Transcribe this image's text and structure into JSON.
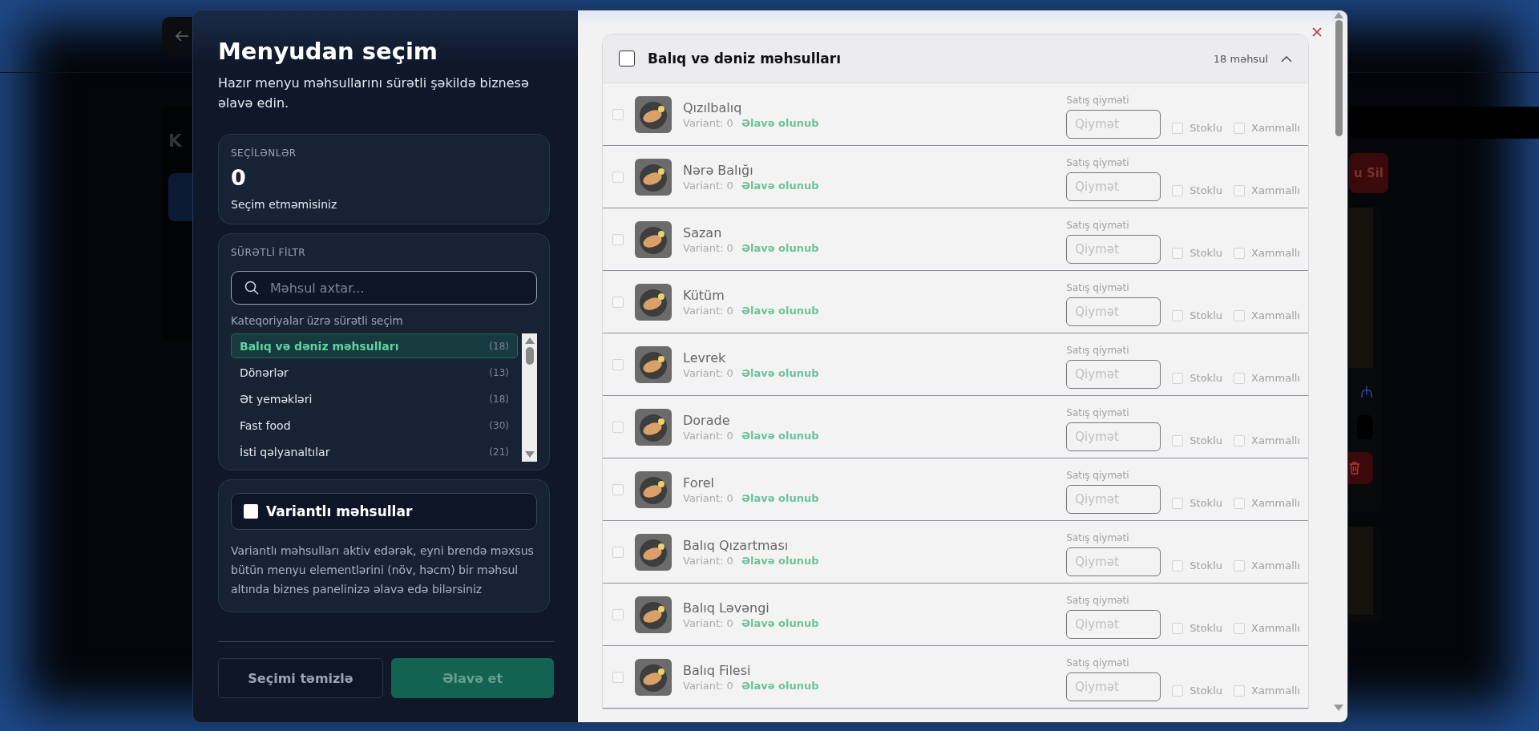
{
  "background": {
    "heading": "K",
    "delete_button": "u Sil",
    "currency": "₼"
  },
  "dialog": {
    "title": "Menyudan seçim",
    "subtitle": "Hazır menyu məhsullarını sürətli şəkildə biznesə əlavə edin.",
    "selected_card": {
      "label": "SEÇİLƏNLƏR",
      "count": "0",
      "note": "Seçim etməmisiniz"
    },
    "filter": {
      "label": "SÜRƏTLİ FİLTR",
      "search_placeholder": "Məhsul axtar...",
      "categories_label": "Kateqoriyalar üzrə sürətli seçim",
      "categories": [
        {
          "name": "Balıq və dəniz məhsulları",
          "count": "(18)",
          "selected": true
        },
        {
          "name": "Dönərlər",
          "count": "(13)",
          "selected": false
        },
        {
          "name": "Ət yeməkləri",
          "count": "(18)",
          "selected": false
        },
        {
          "name": "Fast food",
          "count": "(30)",
          "selected": false
        },
        {
          "name": "İsti qəlyanaltılar",
          "count": "(21)",
          "selected": false
        }
      ]
    },
    "variants": {
      "label": "Variantlı məhsullar",
      "checked": false,
      "description": "Variantlı məhsulları aktiv edərək, eyni brendə məxsus bütün menyu elementlərini (növ, həcm) bir məhsul altında biznes panelinizə əlavə edə bilərsiniz"
    },
    "buttons": {
      "clear": "Seçimi təmizlə",
      "add": "Əlavə et"
    },
    "group": {
      "title": "Balıq və dəniz məhsulları",
      "checked": false,
      "count": "18 məhsul",
      "expanded": true,
      "products": [
        {
          "name": "Qızılbalıq",
          "variant": "Variant: 0",
          "status": "Əlavə olunub",
          "price_label": "Satış qiyməti",
          "price_placeholder": "Qiymət",
          "checked": false,
          "stock_label": "Stoklu",
          "stock": false,
          "ingredient_label": "Xammallı",
          "ingredient": false
        },
        {
          "name": "Nərə Balığı",
          "variant": "Variant: 0",
          "status": "Əlavə olunub",
          "price_label": "Satış qiyməti",
          "price_placeholder": "Qiymət",
          "checked": false,
          "stock_label": "Stoklu",
          "stock": false,
          "ingredient_label": "Xammallı",
          "ingredient": false
        },
        {
          "name": "Sazan",
          "variant": "Variant: 0",
          "status": "Əlavə olunub",
          "price_label": "Satış qiyməti",
          "price_placeholder": "Qiymət",
          "checked": false,
          "stock_label": "Stoklu",
          "stock": false,
          "ingredient_label": "Xammallı",
          "ingredient": false
        },
        {
          "name": "Kütüm",
          "variant": "Variant: 0",
          "status": "Əlavə olunub",
          "price_label": "Satış qiyməti",
          "price_placeholder": "Qiymət",
          "checked": false,
          "stock_label": "Stoklu",
          "stock": false,
          "ingredient_label": "Xammallı",
          "ingredient": false
        },
        {
          "name": "Levrek",
          "variant": "Variant: 0",
          "status": "Əlavə olunub",
          "price_label": "Satış qiyməti",
          "price_placeholder": "Qiymət",
          "checked": false,
          "stock_label": "Stoklu",
          "stock": false,
          "ingredient_label": "Xammallı",
          "ingredient": false
        },
        {
          "name": "Dorade",
          "variant": "Variant: 0",
          "status": "Əlavə olunub",
          "price_label": "Satış qiyməti",
          "price_placeholder": "Qiymət",
          "checked": false,
          "stock_label": "Stoklu",
          "stock": false,
          "ingredient_label": "Xammallı",
          "ingredient": false
        },
        {
          "name": "Forel",
          "variant": "Variant: 0",
          "status": "Əlavə olunub",
          "price_label": "Satış qiyməti",
          "price_placeholder": "Qiymət",
          "checked": false,
          "stock_label": "Stoklu",
          "stock": false,
          "ingredient_label": "Xammallı",
          "ingredient": false
        },
        {
          "name": "Balıq Qızartması",
          "variant": "Variant: 0",
          "status": "Əlavə olunub",
          "price_label": "Satış qiyməti",
          "price_placeholder": "Qiymət",
          "checked": false,
          "stock_label": "Stoklu",
          "stock": false,
          "ingredient_label": "Xammallı",
          "ingredient": false
        },
        {
          "name": "Balıq Ləvəngi",
          "variant": "Variant: 0",
          "status": "Əlavə olunub",
          "price_label": "Satış qiyməti",
          "price_placeholder": "Qiymət",
          "checked": false,
          "stock_label": "Stoklu",
          "stock": false,
          "ingredient_label": "Xammallı",
          "ingredient": false
        },
        {
          "name": "Balıq Filesi",
          "variant": "Variant: 0",
          "status": "Əlavə olunub",
          "price_label": "Satış qiyməti",
          "price_placeholder": "Qiymət",
          "checked": false,
          "stock_label": "Stoklu",
          "stock": false,
          "ingredient_label": "Xammallı",
          "ingredient": false
        }
      ]
    }
  }
}
